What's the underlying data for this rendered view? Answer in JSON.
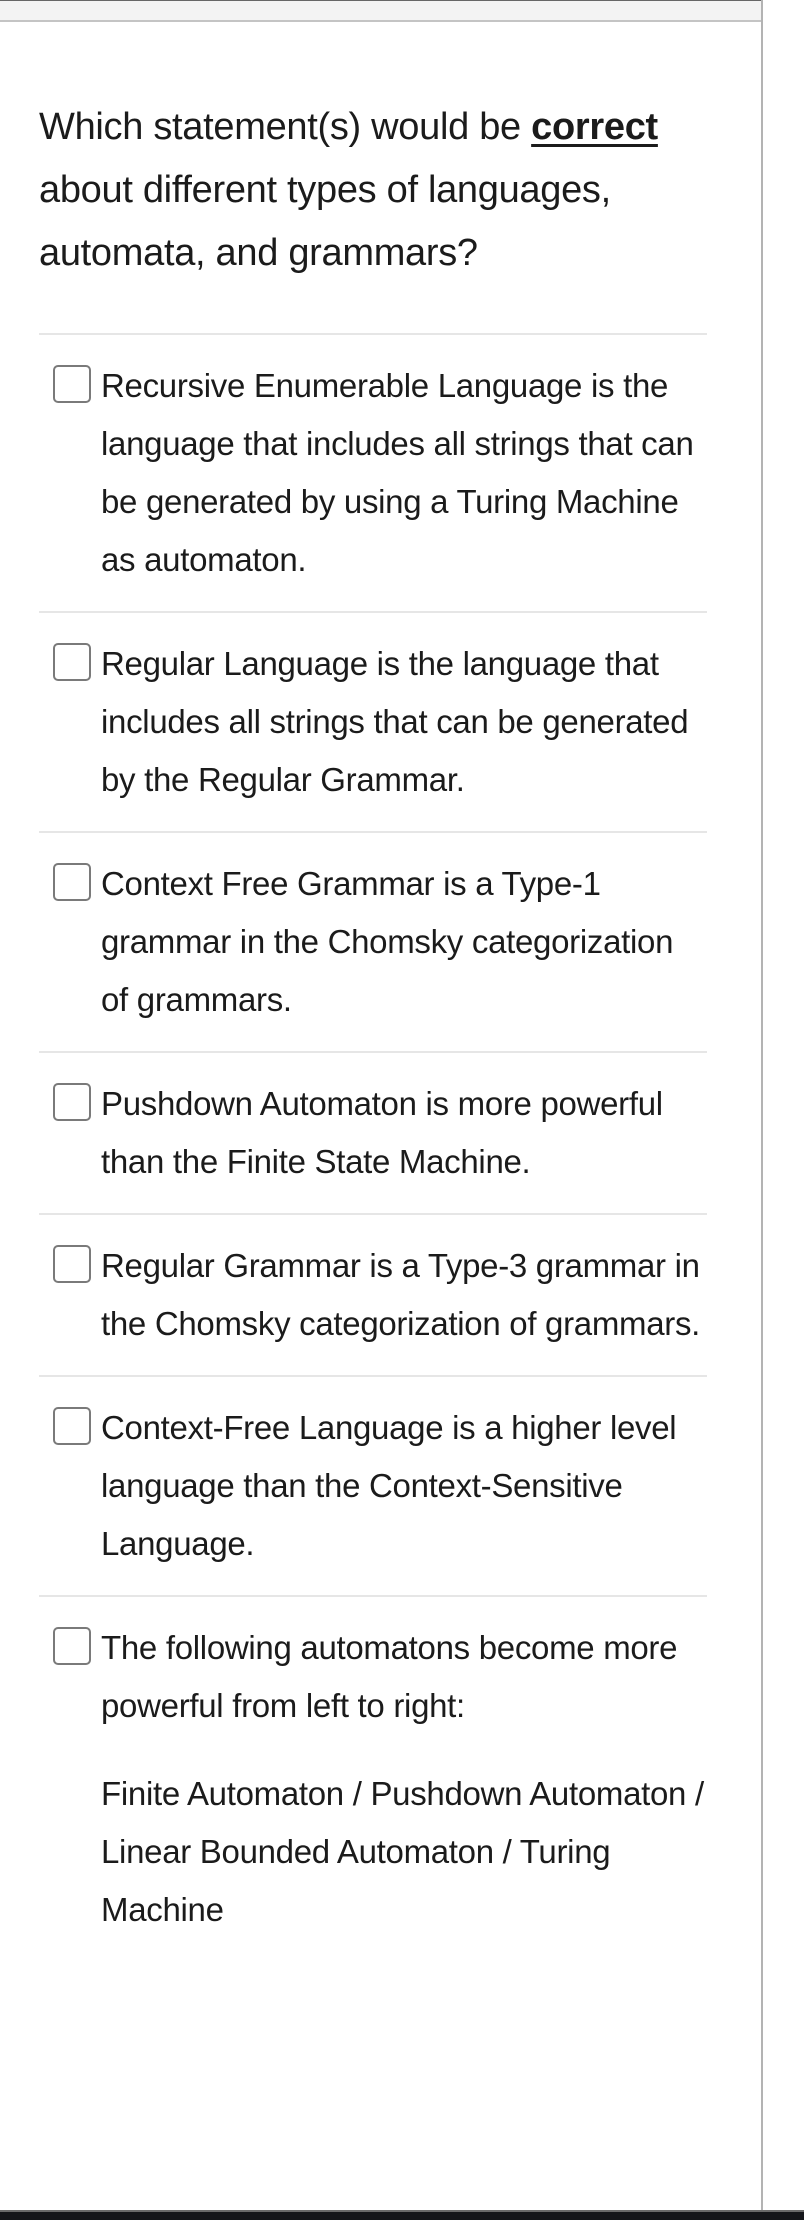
{
  "question": {
    "prefix": "Which statement(s) would be ",
    "emphasis": "correct",
    "suffix": " about different types of languages, automata, and grammars?"
  },
  "answers": [
    {
      "text": "Recursive Enumerable Language is the language that includes all strings that can be generated by using a Turing Machine as automaton.",
      "checked": false
    },
    {
      "text": "Regular Language is the language that includes all strings that can be generated by the Regular Grammar.",
      "checked": false
    },
    {
      "text": "Context Free Grammar is a Type-1 grammar in the Chomsky categorization of grammars.",
      "checked": false
    },
    {
      "text": "Pushdown Automaton is more powerful than the Finite State Machine.",
      "checked": false
    },
    {
      "text": "Regular Grammar is a Type-3 grammar in the Chomsky categorization of grammars.",
      "checked": false
    },
    {
      "text": "Context-Free Language is a higher level language than the Context-Sensitive Language.",
      "checked": false
    },
    {
      "text": "The following automatons become more powerful from left to right:",
      "text2": "Finite Automaton / Pushdown Automaton / Linear Bounded Automaton / Turing Machine",
      "checked": false
    }
  ]
}
